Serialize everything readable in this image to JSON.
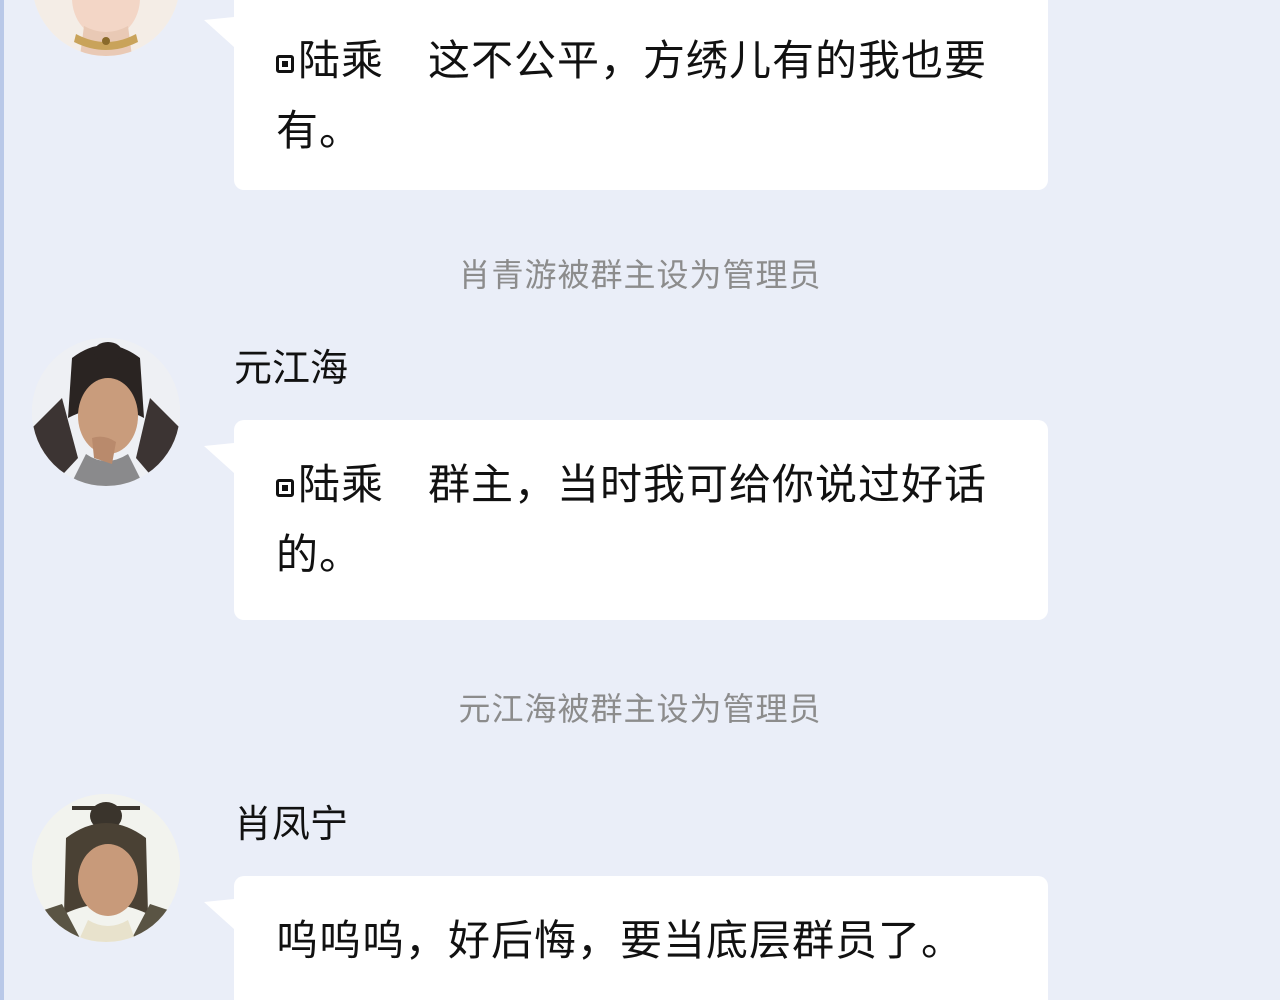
{
  "messages": [
    {
      "mention": "陆乘",
      "text": "这不公平，方绣儿有的我也要有。"
    },
    {
      "system": "肖青游被群主设为管理员"
    },
    {
      "sender": "元江海",
      "mention": "陆乘",
      "text": "群主，当时我可给你说过好话的。"
    },
    {
      "system": "元江海被群主设为管理员"
    },
    {
      "sender": "肖凤宁",
      "text": "呜呜呜，好后悔，要当底层群员了。"
    }
  ]
}
